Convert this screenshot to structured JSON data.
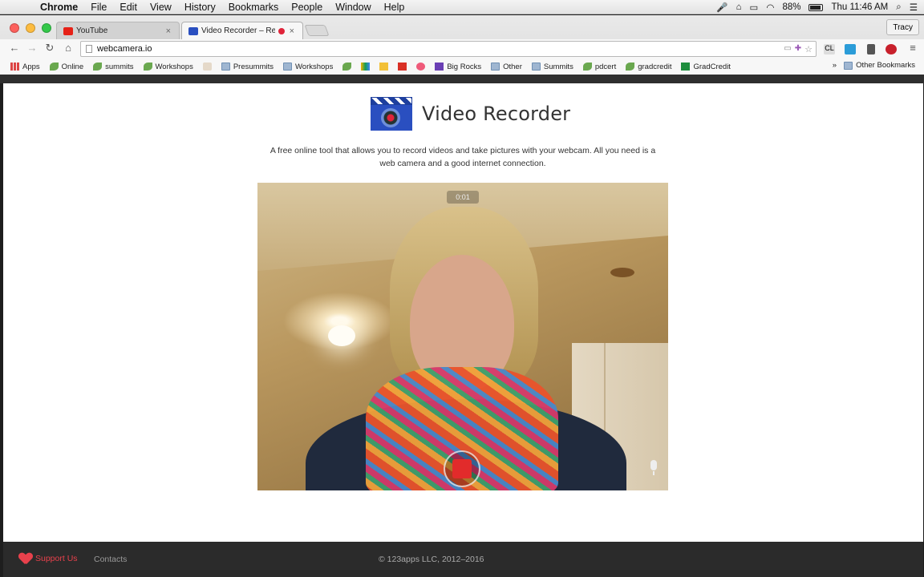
{
  "menubar": {
    "app_name": "Chrome",
    "items": [
      "File",
      "Edit",
      "View",
      "History",
      "Bookmarks",
      "People",
      "Window",
      "Help"
    ],
    "battery": "88%",
    "clock": "Thu 11:46 AM"
  },
  "tabs": [
    {
      "title": "YouTube",
      "favicon_color": "#e62117"
    },
    {
      "title": "Video Recorder – Reco",
      "favicon_color": "#2a4fc0",
      "recording": true
    }
  ],
  "profile": {
    "name": "Tracy"
  },
  "omnibox": {
    "url": "webcamera.io"
  },
  "bookmarks": {
    "items": [
      {
        "label": "Apps",
        "icon": "apps-grid-icon"
      },
      {
        "label": "Online",
        "icon": "leaf-icon"
      },
      {
        "label": "summits",
        "icon": "leaf-icon"
      },
      {
        "label": "Workshops",
        "icon": "leaf-icon"
      },
      {
        "label": "",
        "icon": "feather-icon"
      },
      {
        "label": "Presummits",
        "icon": "folder-icon"
      },
      {
        "label": "Workshops",
        "icon": "folder-icon"
      },
      {
        "label": "",
        "icon": "leaf-icon"
      },
      {
        "label": "",
        "icon": "drive-icon"
      },
      {
        "label": "",
        "icon": "extension-icon"
      },
      {
        "label": "",
        "icon": "extension-icon"
      },
      {
        "label": "",
        "icon": "extension-icon"
      },
      {
        "label": "Big Rocks",
        "icon": "book-icon"
      },
      {
        "label": "Other",
        "icon": "folder-icon"
      },
      {
        "label": "Summits",
        "icon": "folder-icon"
      },
      {
        "label": "pdcert",
        "icon": "leaf-icon"
      },
      {
        "label": "gradcredit",
        "icon": "leaf-icon"
      },
      {
        "label": "GradCredit",
        "icon": "sheet-icon"
      }
    ],
    "more": "»",
    "other_bookmarks": "Other Bookmarks"
  },
  "page": {
    "title": "Video Recorder",
    "description": "A free online tool that allows you to record videos and take pictures with your webcam. All you need is a web camera and a good internet connection.",
    "timer": "0:01"
  },
  "footer": {
    "support": "Support Us",
    "contacts": "Contacts",
    "copyright": "© 123apps LLC, 2012–2016"
  },
  "colors": {
    "accent_red": "#e8414c",
    "record_red": "#e22b2b",
    "footer_bg": "#2b2b2b"
  }
}
